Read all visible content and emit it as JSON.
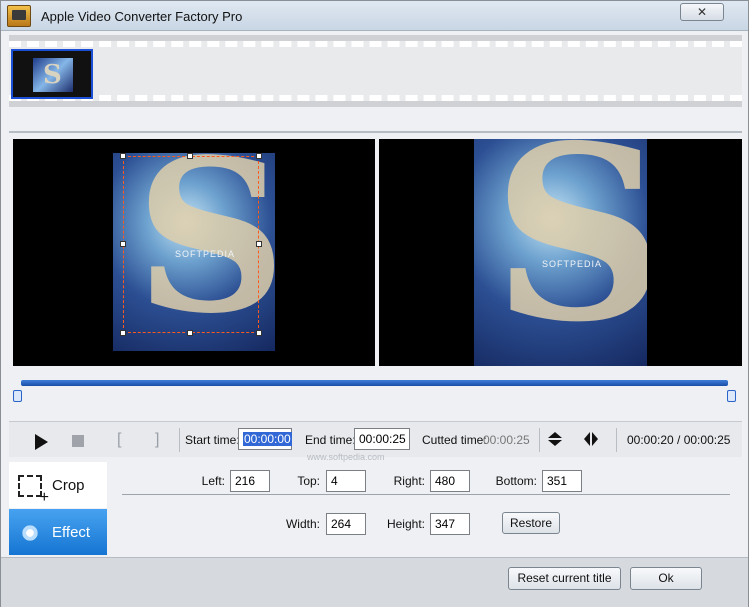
{
  "window": {
    "title": "Apple Video Converter Factory Pro",
    "close_label": "✕"
  },
  "thumbnails": [
    {
      "label": "S"
    }
  ],
  "preview": {
    "watermark_left": "SOFTPEDIA",
    "watermark_right": "SOFTPEDIA",
    "poster_letter": "S"
  },
  "controls": {
    "start_label": "Start time:",
    "start_value": "00:00:00",
    "end_label": "End time:",
    "end_value": "00:00:25",
    "cutted_label": "Cutted time:",
    "cutted_value": "00:00:25",
    "progress_text": "00:00:20 / 00:00:25"
  },
  "watermark_text": "www.softpedia.com",
  "tabs": {
    "crop_label": "Crop",
    "effect_label": "Effect"
  },
  "crop_fields": {
    "left_label": "Left:",
    "left_value": "216",
    "top_label": "Top:",
    "top_value": "4",
    "right_label": "Right:",
    "right_value": "480",
    "bottom_label": "Bottom:",
    "bottom_value": "351",
    "width_label": "Width:",
    "width_value": "264",
    "height_label": "Height:",
    "height_value": "347",
    "restore_label": "Restore"
  },
  "footer": {
    "reset_label": "Reset current title",
    "ok_label": "Ok"
  },
  "colors": {
    "accent": "#1a4fd6",
    "effect_tab": "#1575d2",
    "crop_frame": "#ff5a1e"
  }
}
